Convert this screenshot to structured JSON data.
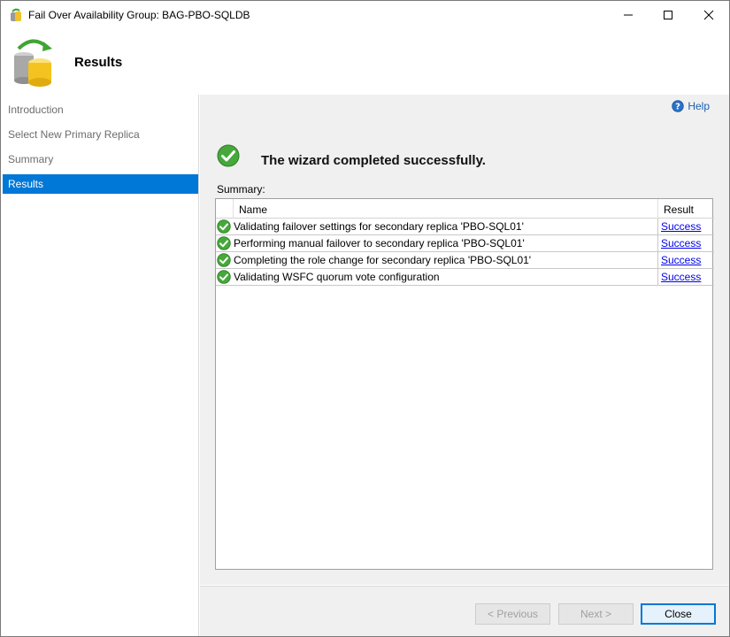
{
  "window": {
    "title": "Fail Over Availability Group: BAG-PBO-SQLDB",
    "controls": [
      "minimize-icon",
      "maximize-icon",
      "close-icon"
    ]
  },
  "header": {
    "title": "Results",
    "icon": "database-failover-icon"
  },
  "sidebar": {
    "items": [
      {
        "label": "Introduction"
      },
      {
        "label": "Select New Primary Replica"
      },
      {
        "label": "Summary"
      },
      {
        "label": "Results",
        "active": true
      }
    ]
  },
  "content": {
    "help_label": "Help",
    "success_message": "The wizard completed successfully.",
    "summary_label": "Summary:",
    "table": {
      "columns": [
        "Name",
        "Result"
      ],
      "rows": [
        {
          "name": "Validating failover settings for secondary replica 'PBO-SQL01'",
          "result": "Success"
        },
        {
          "name": "Performing manual failover to secondary replica 'PBO-SQL01'",
          "result": "Success"
        },
        {
          "name": "Completing the role change for secondary replica 'PBO-SQL01'",
          "result": "Success"
        },
        {
          "name": "Validating WSFC quorum vote configuration",
          "result": "Success"
        }
      ]
    }
  },
  "buttons": {
    "previous": "< Previous",
    "next": "Next >",
    "close": "Close"
  },
  "colors": {
    "accent": "#0078d7",
    "success": "#3fa535",
    "link": "#0000ee",
    "panel": "#f0f0f0"
  }
}
